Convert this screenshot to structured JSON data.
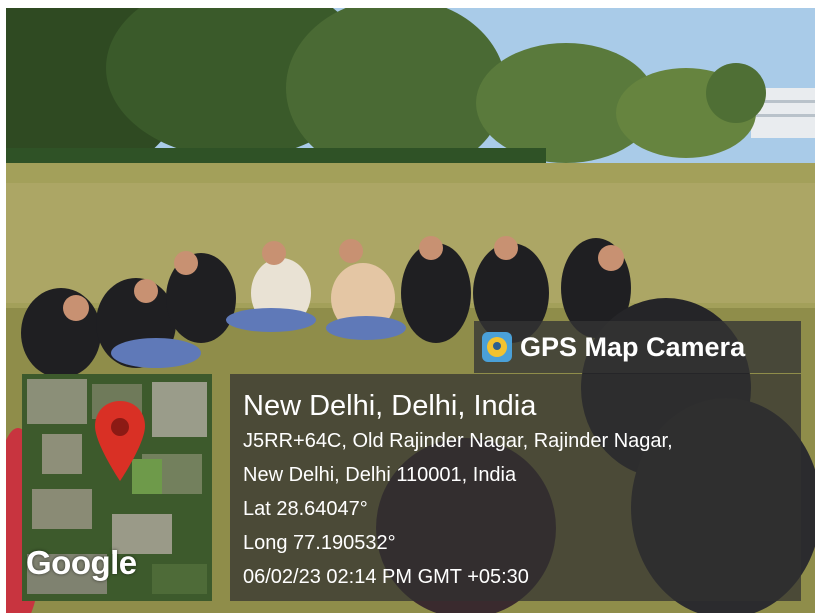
{
  "overlay": {
    "app_badge": "GPS Map Camera",
    "app_icon": "gps-map-camera-app-icon",
    "place": "New Delhi, Delhi, India",
    "address_line_1": "J5RR+64C, Old Rajinder Nagar, Rajinder Nagar,",
    "address_line_2": "New Delhi, Delhi 110001, India",
    "latitude": "Lat 28.64047°",
    "longitude": "Long 77.190532°",
    "timestamp": "06/02/23 02:14 PM GMT +05:30"
  },
  "map_thumbnail": {
    "provider": "Google",
    "pin_icon": "map-pin-icon",
    "pin_color": "#d93025"
  },
  "colors": {
    "sky": "#9fc4e6",
    "lawn": "#a3a05a",
    "tree_dark": "#2f4a22",
    "overlay_bg": "#303030"
  }
}
